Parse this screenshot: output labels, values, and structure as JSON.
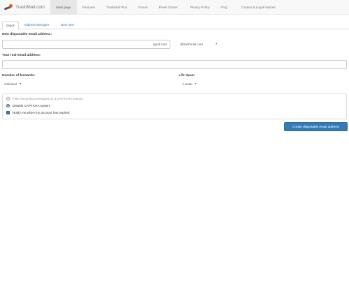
{
  "brand": {
    "name": "TrashMail.com"
  },
  "nav": {
    "items": [
      {
        "label": "Main page",
        "active": true
      },
      {
        "label": "Features"
      },
      {
        "label": "TrashMail Plus"
      },
      {
        "label": "Forum"
      },
      {
        "label": "Press Center"
      },
      {
        "label": "Privacy Policy"
      },
      {
        "label": "FAQ"
      },
      {
        "label": "Contact & Legal Notices"
      }
    ]
  },
  "tabs": [
    {
      "label": "Quick",
      "active": true
    },
    {
      "label": "Address Manager"
    },
    {
      "label": "New user"
    }
  ],
  "form": {
    "new_address_label": "New disposable email address:",
    "new_address_value": "agrol.com",
    "domain_value": "@trashmail.com",
    "real_address_label": "Your real email address:",
    "real_address_value": "",
    "forwards_label": "Number of forwards:",
    "forwards_value": "unlimited",
    "lifespan_label": "Life Span:",
    "lifespan_value": "1 week",
    "options": {
      "captcha_filter": "Filter incoming messages by a CAPTCHA system",
      "captcha_disable": "Disable CAPTCHA system",
      "notify_expire": "Notify me when my account has expired"
    },
    "submit_label": "Create disposable email address"
  },
  "colors": {
    "accent": "#337ab7",
    "navbar_bg": "#f8f8f8",
    "logo_dot": "#e05a2b"
  }
}
